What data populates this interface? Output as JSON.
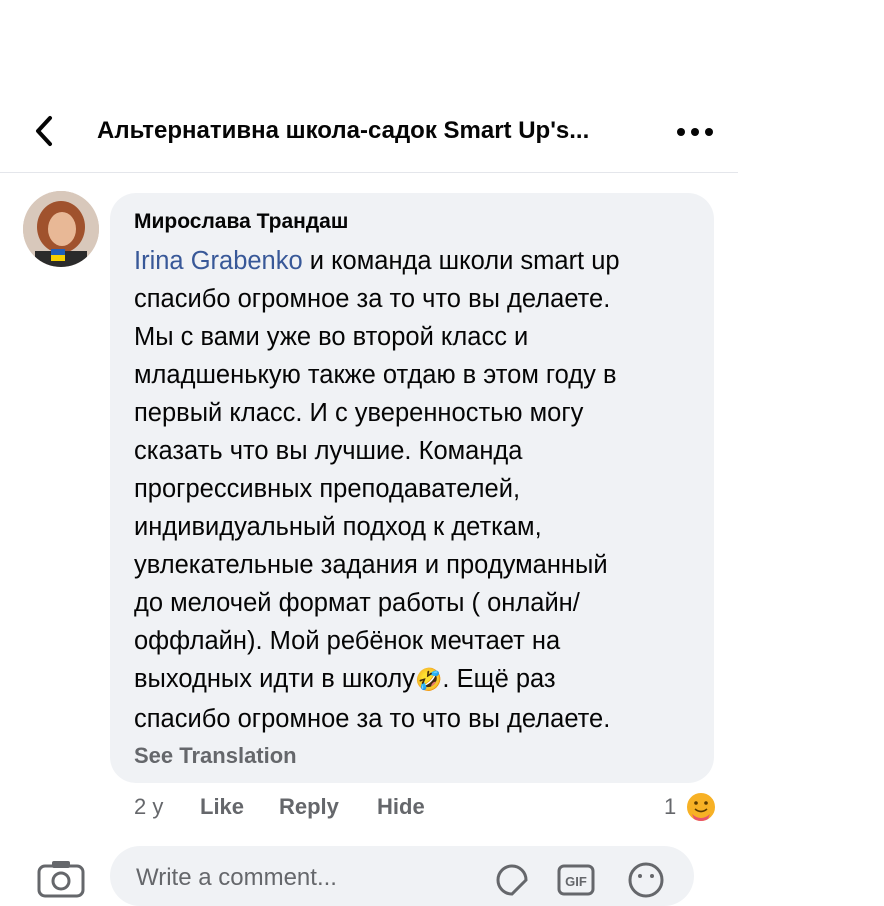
{
  "header": {
    "title": "Альтернативна школа-садок Smart Up's..."
  },
  "comment": {
    "author": "Мирослава Трандаш",
    "mention": "Irina Grabenko",
    "lines": [
      " и команда школи smart up",
      "спасибо огромное за то что вы делаете.",
      "Мы с вами уже  во второй класс и",
      "младшенькую также отдаю в этом году в",
      "первый класс. И с уверенностью  могу",
      "сказать что вы лучшие.  Команда",
      "прогрессивных преподавателей,",
      "индивидуальный подход к деткам,",
      "увлекательные задания и  продуманный",
      "до мелочей  формат  работы ( онлайн/",
      "оффлайн). Мой ребёнок мечтает на",
      "выходных идти в школу",
      ". Ещё раз",
      "спасибо огромное за то что вы делаете."
    ],
    "emoji": "🤣",
    "see_translation": "See Translation",
    "time": "2 y",
    "like": "Like",
    "reply": "Reply",
    "hide": "Hide",
    "reaction_count": "1",
    "reaction_icon": "care-reaction-icon"
  },
  "composer": {
    "placeholder": "Write a comment..."
  },
  "colors": {
    "mention": "#385898",
    "bubble": "#f0f2f5",
    "muted": "#65676b",
    "reaction": "#f7b125"
  }
}
